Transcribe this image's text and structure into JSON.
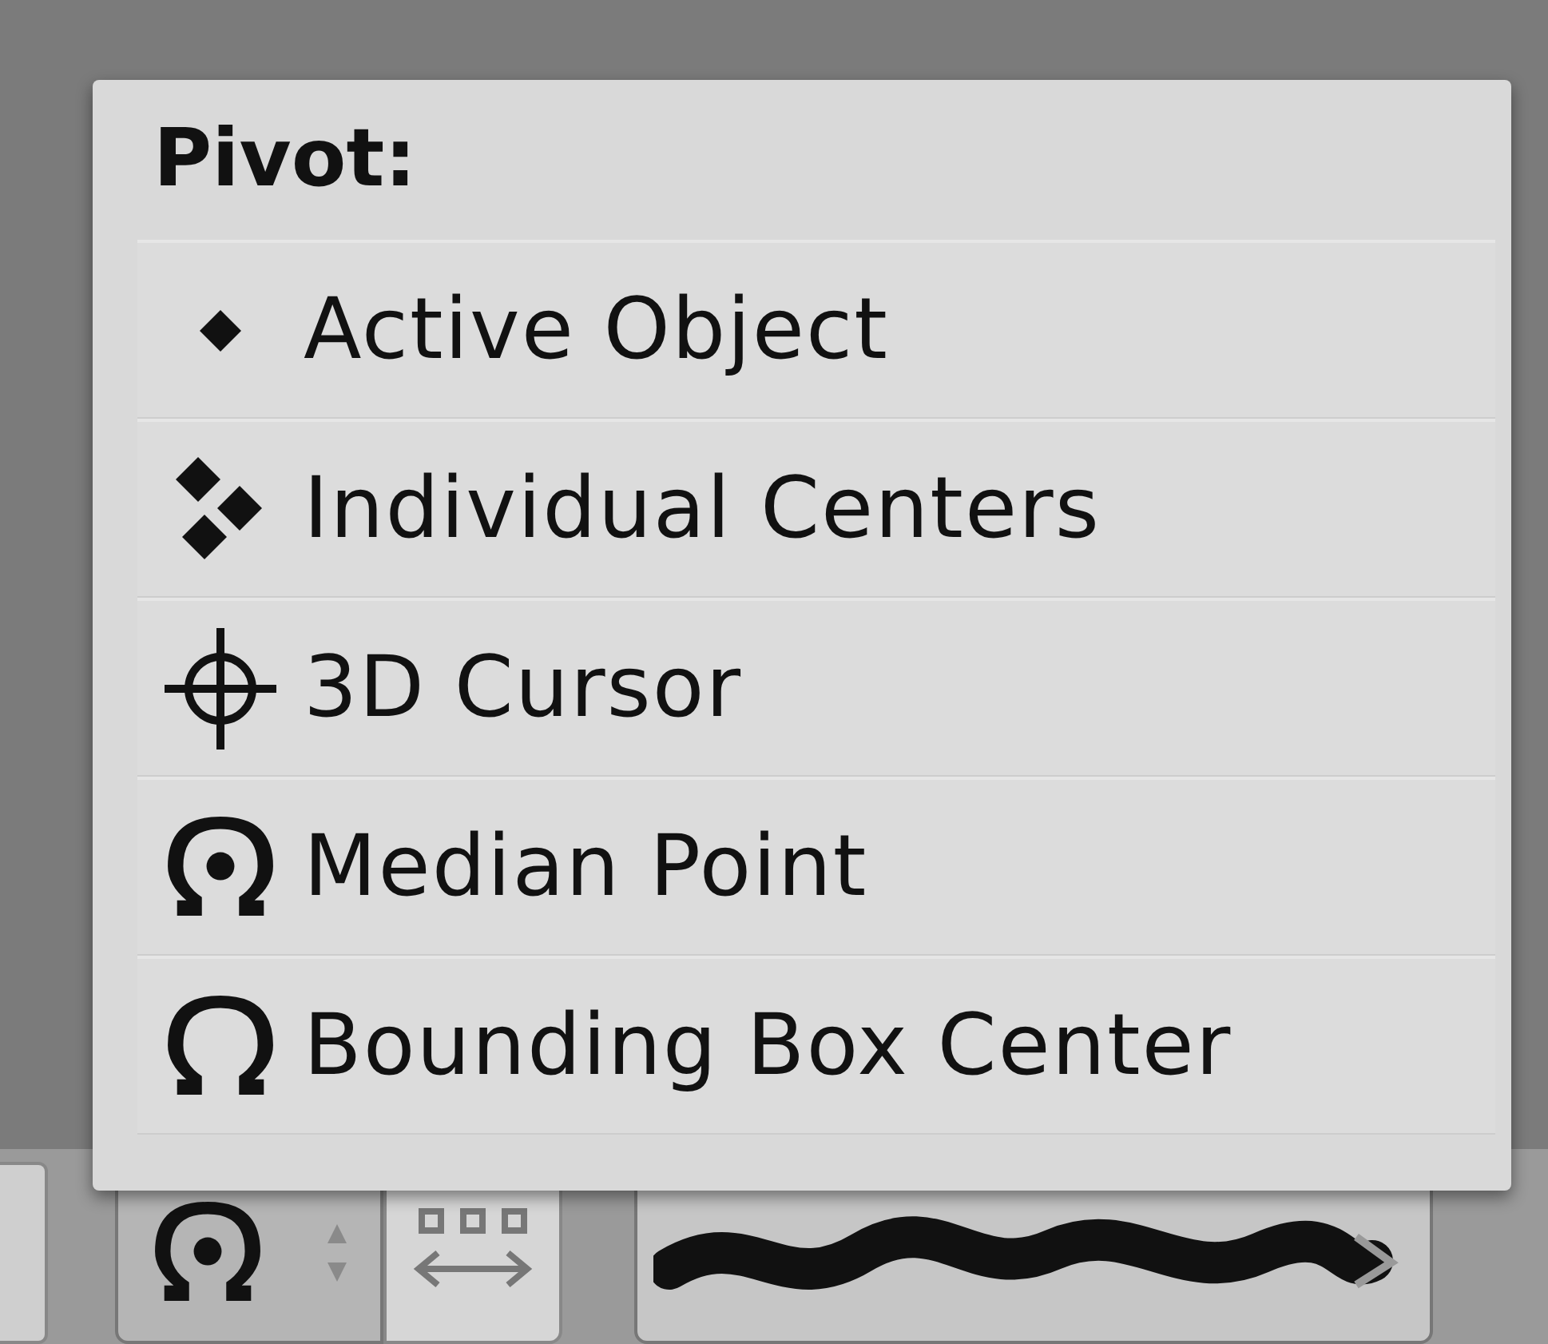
{
  "menu": {
    "title": "Pivot:",
    "items": [
      {
        "label": "Active Object",
        "kind": "active"
      },
      {
        "label": "Individual Centers",
        "kind": "individual"
      },
      {
        "label": "3D Cursor",
        "kind": "cursor"
      },
      {
        "label": "Median Point",
        "kind": "median"
      },
      {
        "label": "Bounding Box Center",
        "kind": "bounding"
      }
    ]
  }
}
